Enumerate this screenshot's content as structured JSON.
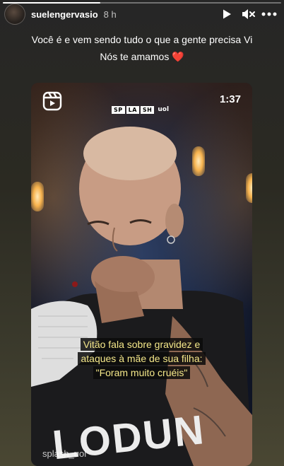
{
  "story": {
    "username": "suelengervasio",
    "time_ago": "8 h",
    "progress": 0.35,
    "caption_line1": "Você é e vem sendo tudo o que a gente precisa Vi",
    "caption_line2": "Nós te amamos",
    "caption_emoji": "❤️"
  },
  "header_icons": [
    "play-icon",
    "mute-icon",
    "more-icon"
  ],
  "reel": {
    "duration": "1:37",
    "brand_letters": [
      "SP",
      "LA",
      "SH"
    ],
    "brand_suffix": "uol",
    "subtitle_line1": "Vitão fala sobre gravidez e",
    "subtitle_line2": "ataques à mãe de sua filha:",
    "subtitle_line3": "\"Foram muito cruéis\"",
    "watermark": "splash_uol",
    "shirt_text": "LODUN"
  },
  "colors": {
    "heart": "#e0292f",
    "subtitle_text": "#f5e88a"
  }
}
